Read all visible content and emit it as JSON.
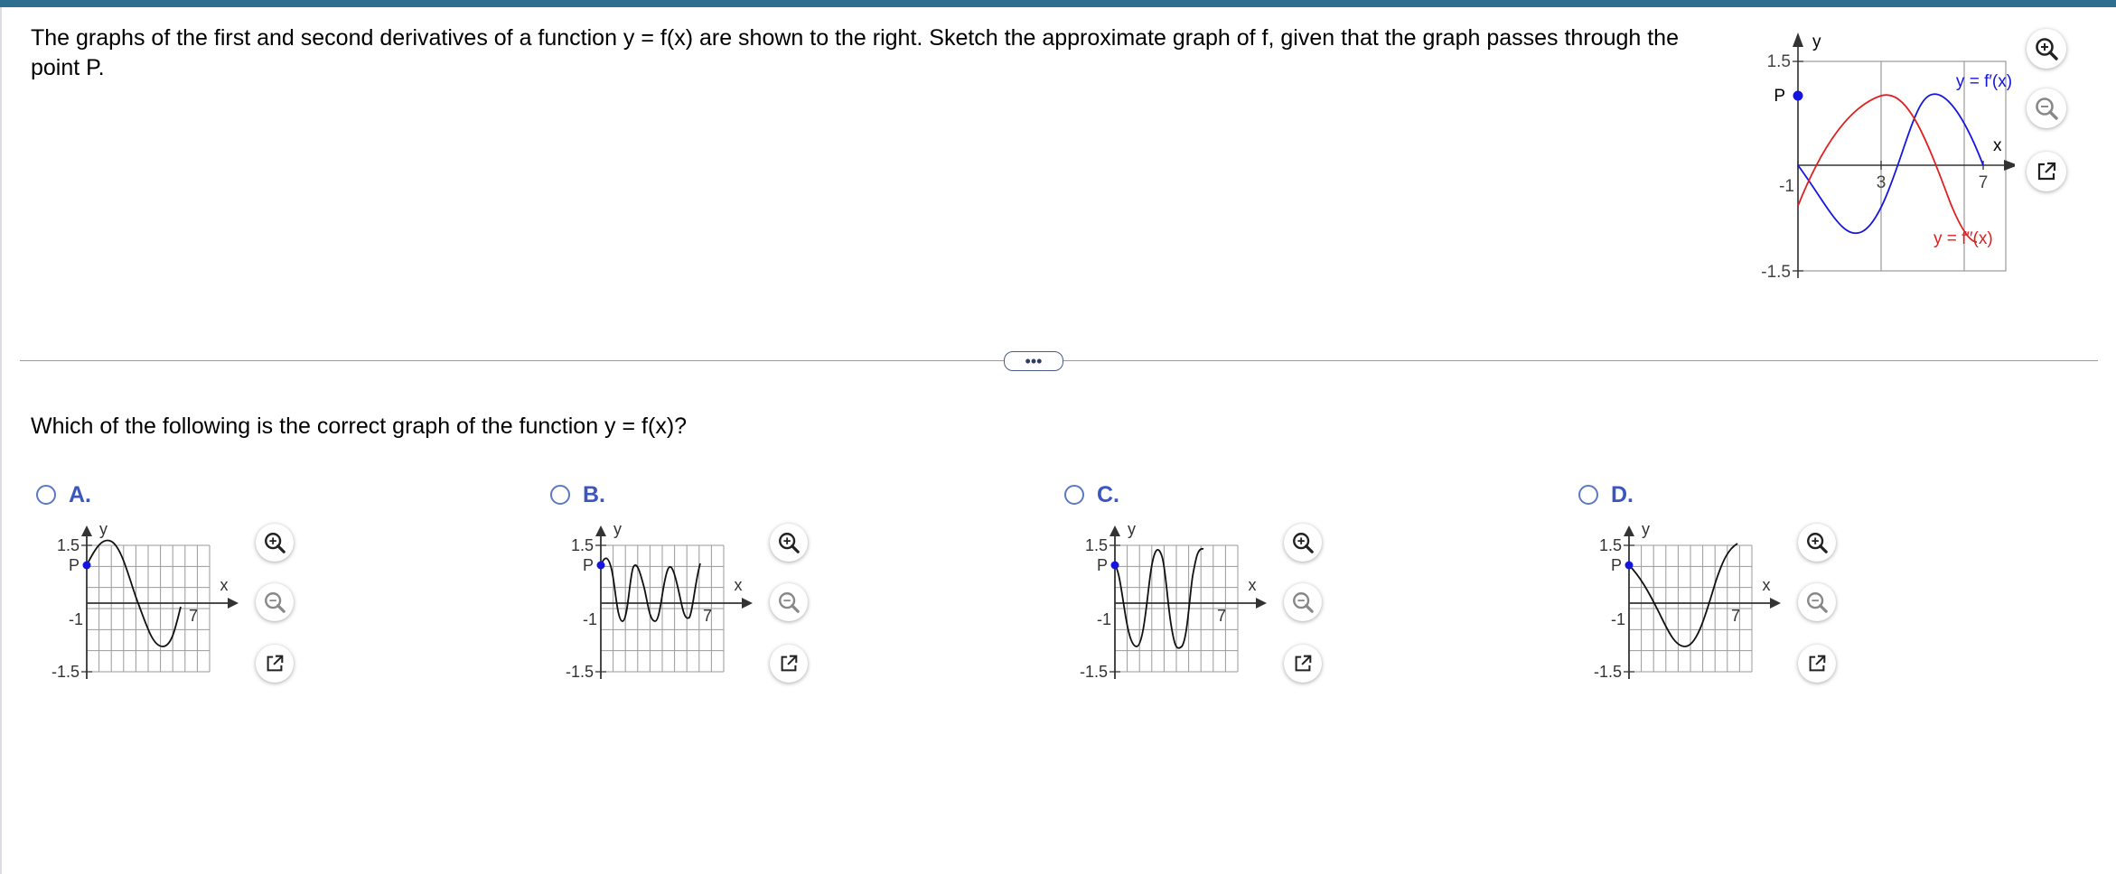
{
  "question": {
    "text": "The graphs of the first and second derivatives of a function y = f(x) are shown to the right. Sketch the approximate graph of f, given that the graph passes through the point P."
  },
  "main_graph": {
    "y_axis_label": "y",
    "x_axis_label": "x",
    "y_tick_top": "1.5",
    "y_tick_bottom": "-1.5",
    "x_tick_left": "-1",
    "x_tick_mid": "3",
    "x_tick_right": "7",
    "point_label": "P",
    "fprime_label": "y = f′(x)",
    "fdoubleprime_label": "y = f′′(x)",
    "colors": {
      "fprime": "#1515e0",
      "fdoubleprime": "#e02020",
      "point": "#1515e0"
    }
  },
  "tools": {
    "zoom_in": "zoom-in-icon",
    "zoom_out": "zoom-out-icon",
    "popout": "popout-icon"
  },
  "expand_button": {
    "label": "•••"
  },
  "prompt": {
    "text": "Which of the following is the correct graph of the function y = f(x)?"
  },
  "choices": [
    {
      "label": "A.",
      "y_axis_label": "y",
      "x_axis_label": "x",
      "tick_top": "1.5",
      "tick_bottom": "-1.5",
      "tick_left": "-1",
      "tick_right": "7",
      "point_label": "P"
    },
    {
      "label": "B.",
      "y_axis_label": "y",
      "x_axis_label": "x",
      "tick_top": "1.5",
      "tick_bottom": "-1.5",
      "tick_left": "-1",
      "tick_right": "7",
      "point_label": "P"
    },
    {
      "label": "C.",
      "y_axis_label": "y",
      "x_axis_label": "x",
      "tick_top": "1.5",
      "tick_bottom": "-1.5",
      "tick_left": "-1",
      "tick_right": "7",
      "point_label": "P"
    },
    {
      "label": "D.",
      "y_axis_label": "y",
      "x_axis_label": "x",
      "tick_top": "1.5",
      "tick_bottom": "-1.5",
      "tick_left": "-1",
      "tick_right": "7",
      "point_label": "P"
    }
  ]
}
